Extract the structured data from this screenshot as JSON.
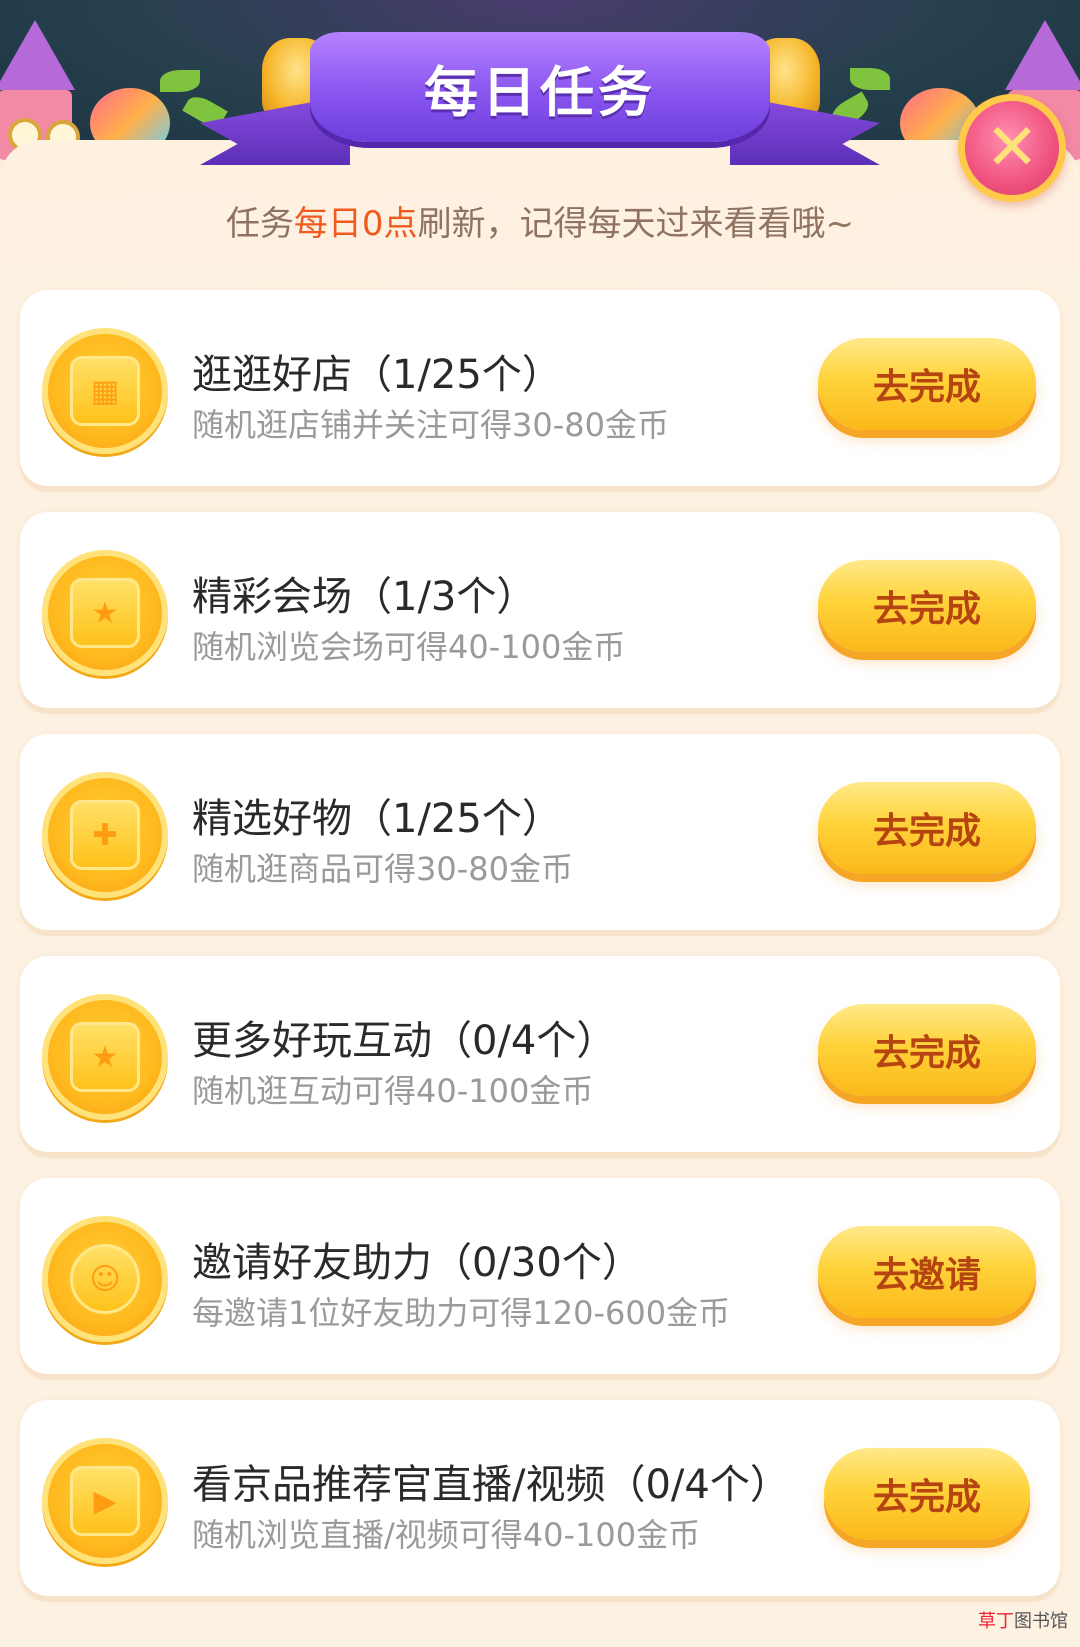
{
  "header": {
    "title": "每日任务",
    "close_icon": "close-icon",
    "subtitle_prefix": "任务",
    "subtitle_highlight": "每日0点",
    "subtitle_suffix": "刷新，记得每天过来看看哦~"
  },
  "tasks": [
    {
      "icon": "shop-icon",
      "title": "逛逛好店（1/25个）",
      "desc": "随机逛店铺并关注可得30-80金币",
      "button": "去完成"
    },
    {
      "icon": "shopping-bag-star-icon",
      "title": "精彩会场（1/3个）",
      "desc": "随机浏览会场可得40-100金币",
      "button": "去完成"
    },
    {
      "icon": "gift-icon",
      "title": "精选好物（1/25个）",
      "desc": "随机逛商品可得30-80金币",
      "button": "去完成"
    },
    {
      "icon": "box-star-icon",
      "title": "更多好玩互动（0/4个）",
      "desc": "随机逛互动可得40-100金币",
      "button": "去完成"
    },
    {
      "icon": "user-smile-icon",
      "title": "邀请好友助力（0/30个）",
      "desc": "每邀请1位好友助力可得120-600金币",
      "button": "去邀请"
    },
    {
      "icon": "tv-play-icon",
      "title": "看京品推荐官直播/视频（0/4个）",
      "desc": "随机浏览直播/视频可得40-100金币",
      "button": "去完成"
    }
  ],
  "watermark": {
    "part1": "草丁",
    "part2": "图书馆"
  },
  "colors": {
    "accent_orange": "#f05a1e",
    "button_text": "#b54410",
    "ribbon_purple": "#8a55ef",
    "coin_yellow": "#ffba1f"
  }
}
